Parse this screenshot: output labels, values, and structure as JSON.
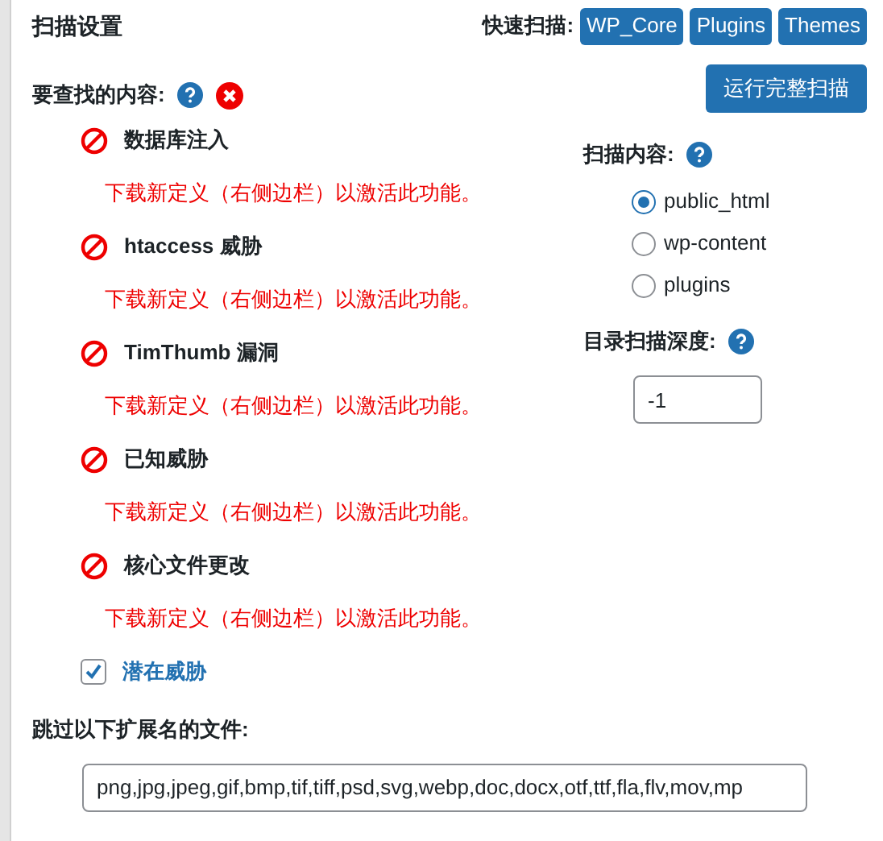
{
  "title": "扫描设置",
  "quick_scan": {
    "label": "快速扫描:",
    "buttons": [
      "WP_Core",
      "Plugins",
      "Themes"
    ]
  },
  "run_button": "运行完整扫描",
  "find_label": "要查找的内容:",
  "items": [
    {
      "kind": "disabled",
      "label": "数据库注入",
      "message": "下载新定义（右侧边栏）以激活此功能。"
    },
    {
      "kind": "disabled",
      "label": "htaccess 威胁",
      "message": "下载新定义（右侧边栏）以激活此功能。"
    },
    {
      "kind": "disabled",
      "label": "TimThumb 漏洞",
      "message": "下载新定义（右侧边栏）以激活此功能。"
    },
    {
      "kind": "disabled",
      "label": "已知威胁",
      "message": "下载新定义（右侧边栏）以激活此功能。"
    },
    {
      "kind": "disabled",
      "label": "核心文件更改",
      "message": "下载新定义（右侧边栏）以激活此功能。"
    },
    {
      "kind": "checkbox",
      "label": "潜在威胁",
      "checked": true
    }
  ],
  "scan_content": {
    "label": "扫描内容:",
    "options": [
      {
        "label": "public_html",
        "selected": true
      },
      {
        "label": "wp-content",
        "selected": false
      },
      {
        "label": "plugins",
        "selected": false
      }
    ]
  },
  "depth": {
    "label": "目录扫描深度:",
    "value": "-1"
  },
  "skip": {
    "label": "跳过以下扩展名的文件:",
    "value": "png,jpg,jpeg,gif,bmp,tif,tiff,psd,svg,webp,doc,docx,otf,ttf,fla,flv,mov,mp"
  }
}
